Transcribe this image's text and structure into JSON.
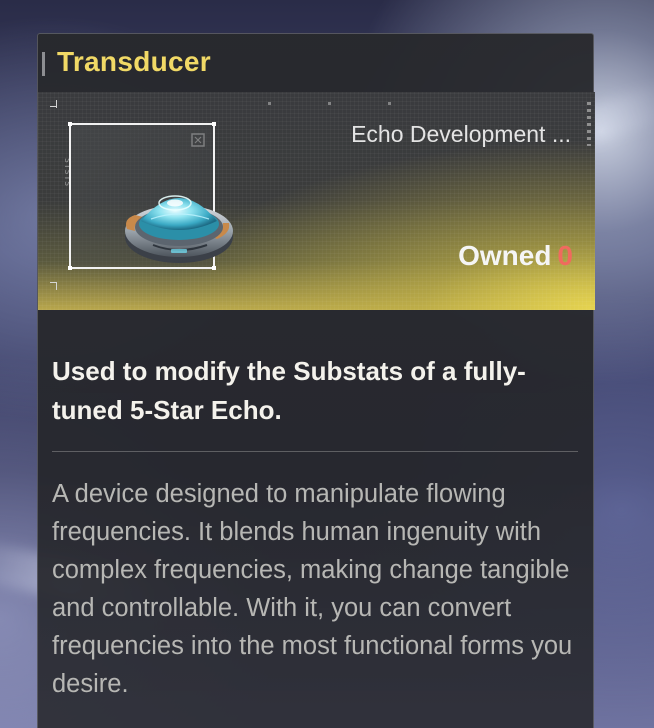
{
  "item": {
    "name": "Transducer",
    "category": "Echo Development ...",
    "owned_label": "Owned",
    "owned_count": "0",
    "icon": "transducer-device-icon",
    "summary": "Used to modify the Substats of a fully-tuned 5-Star Echo.",
    "description": "A device designed to manipulate flowing frequencies. It blends human ingenuity with complex frequencies, making change tangible and controllable. With it, you can convert frequencies into the most functional forms you desire."
  },
  "colors": {
    "title": "#f1d966",
    "owned_count": "#f06a5e",
    "summary": "#f4f2ec",
    "description": "#b7b7b4",
    "hero_glow": "#e8d650"
  }
}
